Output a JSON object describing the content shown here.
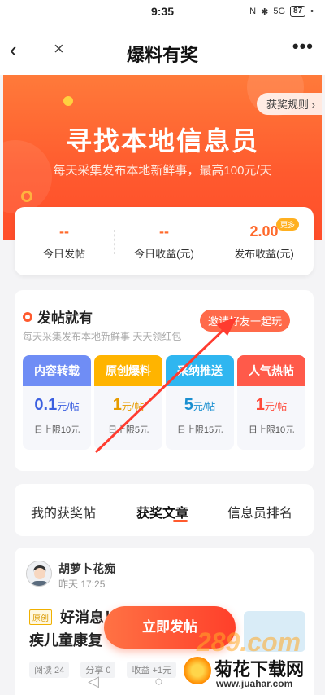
{
  "status_bar": {
    "time": "9:35",
    "signal": "5G",
    "battery": "87"
  },
  "nav": {
    "back_glyph": "‹",
    "close_glyph": "×",
    "title": "爆料有奖",
    "more_glyph": "•••"
  },
  "banner": {
    "rules_button": "获奖规则 ›",
    "title": "寻找本地信息员",
    "subtitle": "每天采集发布本地新鲜事，最高100元/天"
  },
  "stats": {
    "items": [
      {
        "value": "--",
        "label": "今日发帖"
      },
      {
        "value": "--",
        "label": "今日收益(元)"
      },
      {
        "value": "2.00",
        "label": "发布收益(元)"
      }
    ],
    "more_badge": "更多"
  },
  "post_section": {
    "heading": "发帖就有",
    "subtitle": "每天采集发布本地新鲜事 天天领红包",
    "invite_button": "邀请好友一起玩",
    "categories": [
      {
        "name": "内容转载",
        "price": "0.1",
        "unit": "元/帖",
        "limit": "日上限10元",
        "color": "#6f8df5",
        "price_color": "#3b5fe0"
      },
      {
        "name": "原创爆料",
        "price": "1",
        "unit": "元/帖",
        "limit": "日上限5元",
        "color": "#ffb400",
        "price_color": "#e69b00"
      },
      {
        "name": "采纳推送",
        "price": "5",
        "unit": "元/帖",
        "limit": "日上限15元",
        "color": "#2fb6f0",
        "price_color": "#1a8fd0"
      },
      {
        "name": "人气热帖",
        "price": "1",
        "unit": "元/帖",
        "limit": "日上限10元",
        "color": "#ff5a4a",
        "price_color": "#ff4a3a"
      }
    ]
  },
  "tabs": [
    {
      "label": "我的获奖帖"
    },
    {
      "label": "获奖文章"
    },
    {
      "label": "信息员排名"
    }
  ],
  "article": {
    "author": "胡萝卜花痴",
    "time": "昨天 17:25",
    "tag": "原创",
    "title_line1": "好消息！",
    "title_line2": "疾儿童康复",
    "stats": [
      "阅读 24",
      "分享 0",
      "收益 +1元"
    ]
  },
  "post_now_button": "立即发帖",
  "watermark": {
    "number": "289.com",
    "name": "菊花下载网",
    "url": "www.juahar.com"
  },
  "colors": {
    "accent": "#ff5a2e",
    "banner_top": "#ff7a3a"
  }
}
